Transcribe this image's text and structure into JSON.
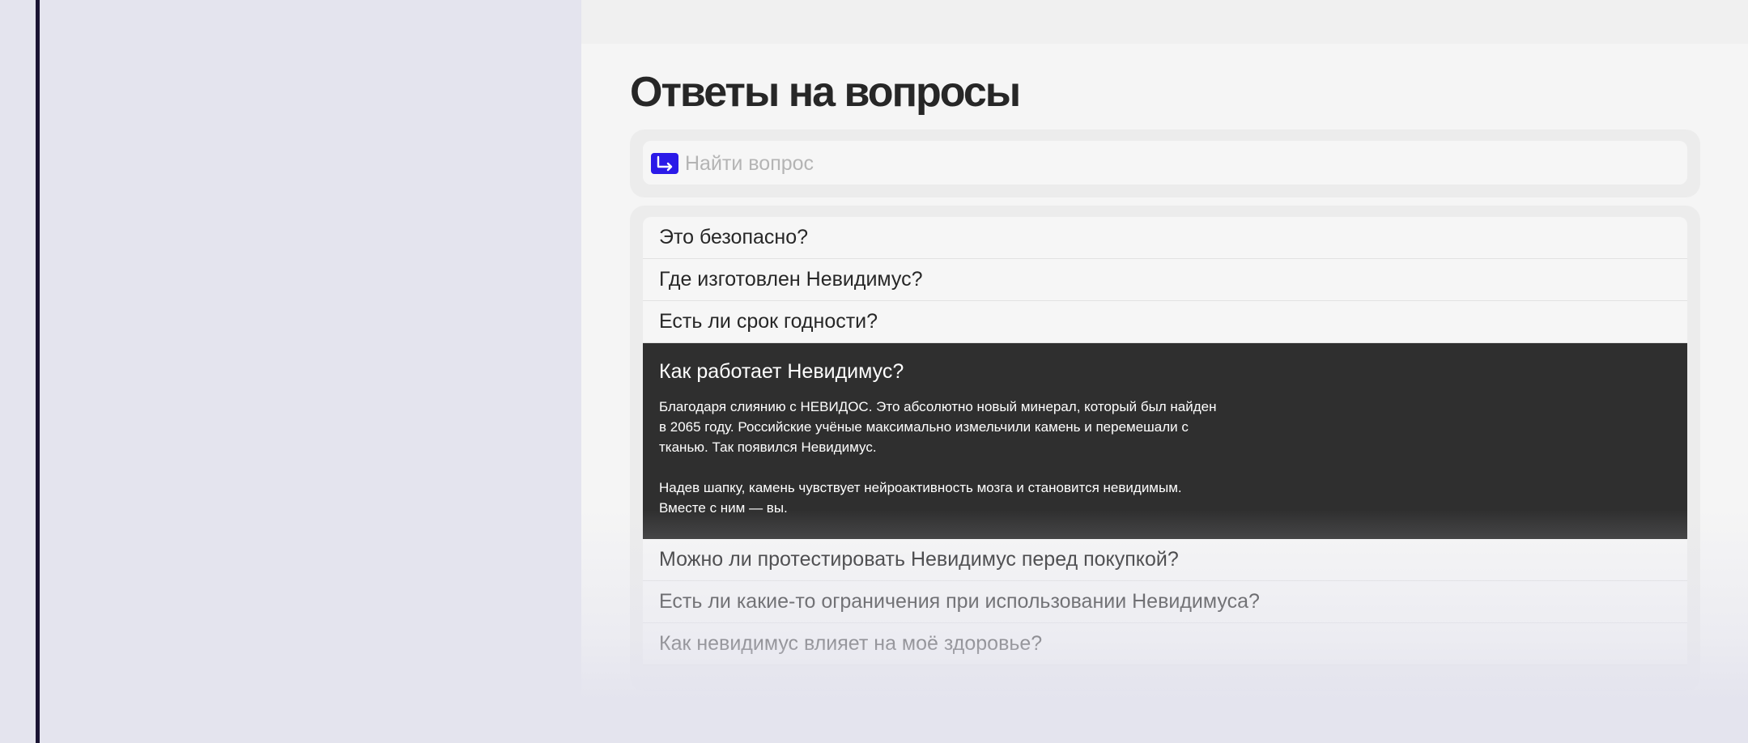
{
  "faq": {
    "title": "Ответы на вопросы",
    "search": {
      "placeholder": "Найти вопрос",
      "icon": "arrow-corner-icon",
      "accent": "#2b1ae8"
    },
    "items": [
      {
        "question": "Это безопасно?"
      },
      {
        "question": "Где изготовлен Невидимус?"
      },
      {
        "question": "Есть ли срок годности?"
      },
      {
        "question": "Как работает Невидимус?",
        "expanded": true,
        "answer_p1": "Благодаря слиянию с НЕВИДОС. Это абсолютно новый минерал, который был найден в 2065 году. Российские учёные максимально измельчили камень и перемешали с тканью. Так появился Невидимус.",
        "answer_p2": "Надев шапку, камень чувствует нейроактивность мозга и становится невидимым. Вместе с ним — вы."
      },
      {
        "question": "Можно ли протестировать Невидимус перед покупкой?"
      },
      {
        "question": "Есть ли какие-то ограничения при использовании Невидимуса?"
      },
      {
        "question": "Как невидимус влияет на моё здоровье?"
      }
    ]
  }
}
